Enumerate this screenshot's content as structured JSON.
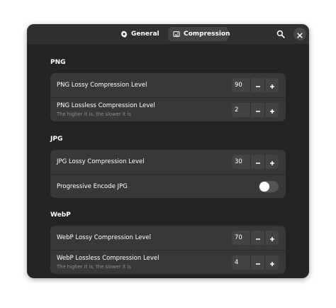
{
  "tabs": [
    {
      "label": "General",
      "icon": "gear-icon",
      "selected": false
    },
    {
      "label": "Compression",
      "icon": "image-icon",
      "selected": true
    }
  ],
  "sections": {
    "png": {
      "title": "PNG",
      "lossy": {
        "label": "PNG Lossy Compression Level",
        "value": "90"
      },
      "lossless": {
        "label": "PNG Lossless Compression Level",
        "subtitle": "The higher it is, the slower it is",
        "value": "2"
      }
    },
    "jpg": {
      "title": "JPG",
      "lossy": {
        "label": "JPG Lossy Compression Level",
        "value": "30"
      },
      "progressive": {
        "label": "Progressive Encode JPG",
        "enabled": false
      }
    },
    "webp": {
      "title": "WebP",
      "lossy": {
        "label": "WebP Lossy Compression Level",
        "value": "70"
      },
      "lossless": {
        "label": "WebP Lossless Compression Level",
        "subtitle": "The higher it is, the slower it is",
        "value": "4"
      }
    }
  },
  "colors": {
    "window_bg": "#242424",
    "headerbar_bg": "#303030",
    "group_bg": "#383838",
    "text": "#ffffff",
    "subtitle": "#8f8f8f"
  }
}
